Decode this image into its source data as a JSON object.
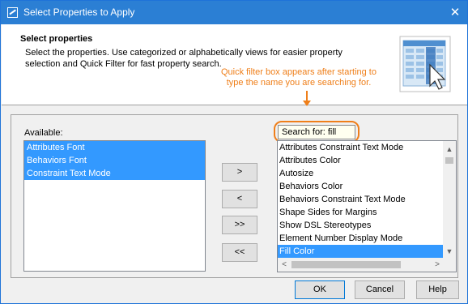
{
  "window": {
    "title": "Select Properties to Apply",
    "close_glyph": "✕"
  },
  "header": {
    "title": "Select properties",
    "description": "Select the properties. Use categorized or alphabetically views for easier property selection and Quick Filter for fast property search."
  },
  "annotation": {
    "text": "Quick filter box appears after starting to type the name you are searching for.",
    "color": "#ef7f1a"
  },
  "available": {
    "label": "Available:",
    "items": [
      "Attributes Font",
      "Behaviors Font",
      "Constraint Text Mode"
    ]
  },
  "search": {
    "label": "Search for: fill"
  },
  "selected_list": {
    "items": [
      "Attributes Constraint Text Mode",
      "Attributes Color",
      "Autosize",
      "Behaviors Color",
      "Behaviors Constraint Text Mode",
      "Shape Sides for Margins",
      "Show DSL Stereotypes",
      "Element Number Display Mode",
      "Fill Color"
    ],
    "selected_item": "Fill Color"
  },
  "move_buttons": {
    "add": ">",
    "remove": "<",
    "add_all": ">>",
    "remove_all": "<<"
  },
  "footer": {
    "ok": "OK",
    "cancel": "Cancel",
    "help": "Help"
  },
  "colors": {
    "titlebar": "#2b7fd4",
    "selection": "#3399ff",
    "accent": "#ef7f1a"
  }
}
